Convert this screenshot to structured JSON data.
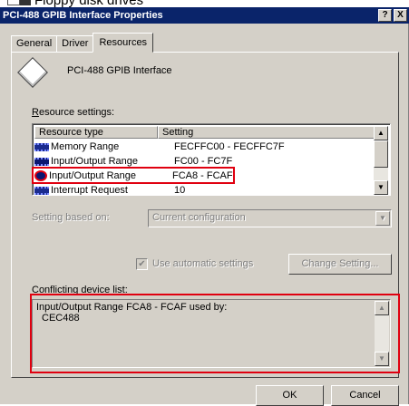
{
  "background": {
    "title": "Floppy disk drives"
  },
  "window": {
    "title": "PCI-488 GPIB Interface Properties",
    "help_btn": "?",
    "close_btn": "X"
  },
  "tabs": [
    {
      "label": "General"
    },
    {
      "label": "Driver"
    },
    {
      "label": "Resources"
    }
  ],
  "device": {
    "name": "PCI-488 GPIB Interface",
    "icon": "diamond-device-icon"
  },
  "resource_settings": {
    "label": "Resource settings:",
    "columns": [
      "Resource type",
      "Setting"
    ],
    "rows": [
      {
        "type": "Memory Range",
        "setting": "FECFFC00 - FECFFC7F",
        "icon": "memory-range-icon"
      },
      {
        "type": "Input/Output Range",
        "setting": "FC00 - FC7F",
        "icon": "io-range-icon"
      },
      {
        "type": "Input/Output Range",
        "setting": "FCA8 - FCAF",
        "icon": "conflict-io-range-icon"
      },
      {
        "type": "Interrupt Request",
        "setting": "10",
        "icon": "irq-icon"
      }
    ]
  },
  "setting_based_on": {
    "label": "Setting based on:",
    "value": "Current configuration"
  },
  "auto_settings": {
    "label": "Use automatic settings",
    "checked": true
  },
  "change_setting_button": "Change Setting...",
  "conflicts": {
    "label": "Conflicting device list:",
    "lines": [
      "Input/Output Range FCA8 - FCAF used by:",
      "CEC488"
    ]
  },
  "buttons": {
    "ok": "OK",
    "cancel": "Cancel"
  },
  "colors": {
    "highlight": "#e00010",
    "titlebar": "#0a246a",
    "face": "#d4d0c8"
  }
}
